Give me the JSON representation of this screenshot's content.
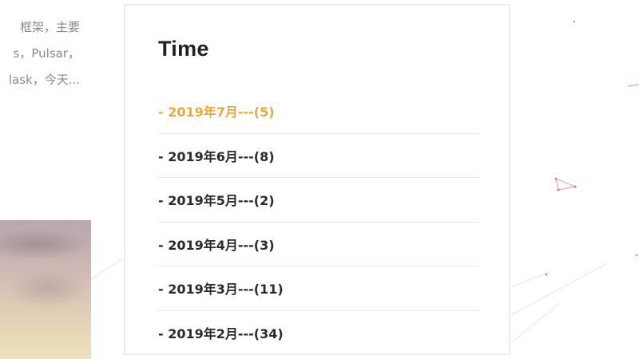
{
  "colors": {
    "accent": "#e9a93a",
    "text": "#2a2a2a",
    "muted": "#8a8a8a",
    "border": "#ececec"
  },
  "excerpt": {
    "lines": [
      "框架，主要",
      "s，Pulsar，",
      "lask，今天..."
    ]
  },
  "widget": {
    "title": "Time",
    "items": [
      {
        "label": "- 2019年7月---(5)",
        "active": true
      },
      {
        "label": "- 2019年6月---(8)",
        "active": false
      },
      {
        "label": "- 2019年5月---(2)",
        "active": false
      },
      {
        "label": "- 2019年4月---(3)",
        "active": false
      },
      {
        "label": "- 2019年3月---(11)",
        "active": false
      },
      {
        "label": "- 2019年2月---(34)",
        "active": false
      }
    ]
  }
}
